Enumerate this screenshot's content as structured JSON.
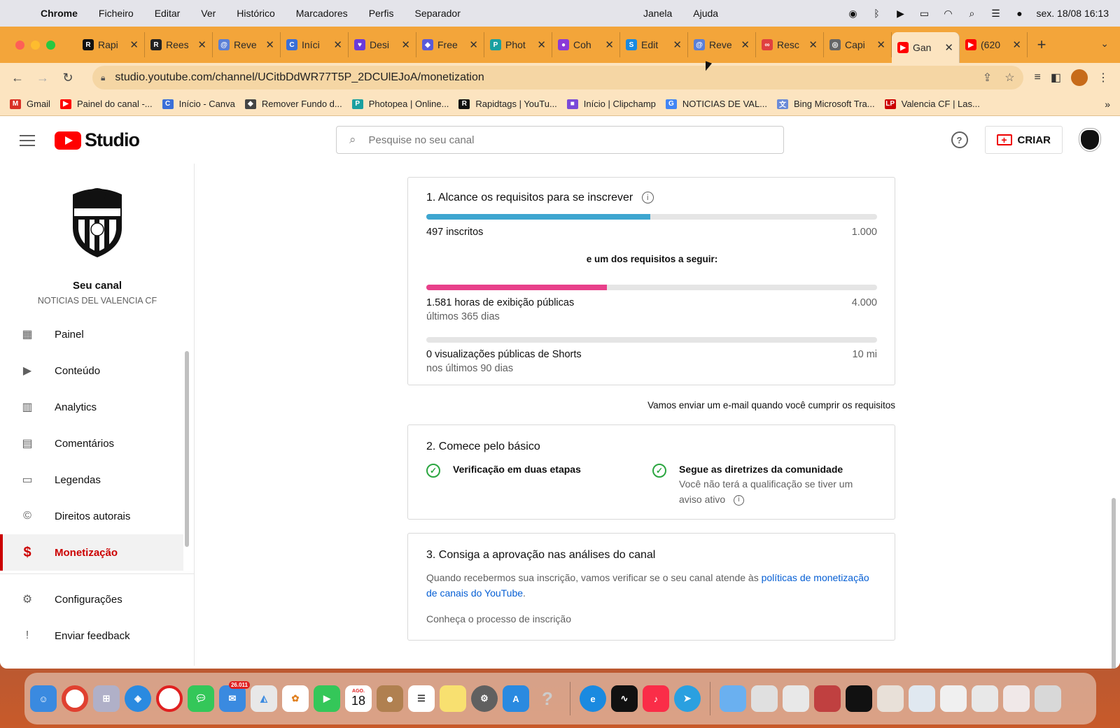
{
  "menubar": {
    "app": "Chrome",
    "items": [
      "Ficheiro",
      "Editar",
      "Ver",
      "Histórico",
      "Marcadores",
      "Perfis",
      "Separador"
    ],
    "center_items": [
      "Janela",
      "Ajuda"
    ],
    "datetime": "sex. 18/08  16:13"
  },
  "tabs": [
    {
      "title": "Rapi",
      "icon": "R",
      "color": "#111"
    },
    {
      "title": "Rees",
      "icon": "R",
      "color": "#222"
    },
    {
      "title": "Reve",
      "icon": "@",
      "color": "#5a7fd6"
    },
    {
      "title": "Iníci",
      "icon": "C",
      "color": "#3a6fd8"
    },
    {
      "title": "Desi",
      "icon": "♥",
      "color": "#6a3ad8"
    },
    {
      "title": "Free",
      "icon": "◆",
      "color": "#5a5ad8"
    },
    {
      "title": "Phot",
      "icon": "P",
      "color": "#1aa0a0"
    },
    {
      "title": "Coh",
      "icon": "●",
      "color": "#8a3ad8"
    },
    {
      "title": "Edit",
      "icon": "S",
      "color": "#1a8ae0"
    },
    {
      "title": "Reve",
      "icon": "@",
      "color": "#5a7fd6"
    },
    {
      "title": "Resc",
      "icon": "∞",
      "color": "#e04040"
    },
    {
      "title": "Capi",
      "icon": "◎",
      "color": "#666"
    },
    {
      "title": "Gan",
      "icon": "▶",
      "color": "#ff0000",
      "active": true
    },
    {
      "title": "(620",
      "icon": "▶",
      "color": "#ff0000"
    }
  ],
  "address": {
    "url": "studio.youtube.com/channel/UCitbDdWR77T5P_2DCUlEJoA/monetization"
  },
  "bookmarks": [
    {
      "label": "Gmail",
      "icon": "M",
      "color": "#d93025"
    },
    {
      "label": "Painel do canal -...",
      "icon": "▶",
      "color": "#ff0000"
    },
    {
      "label": "Início - Canva",
      "icon": "C",
      "color": "#3a6fd8"
    },
    {
      "label": "Remover Fundo d...",
      "icon": "◆",
      "color": "#444"
    },
    {
      "label": "Photopea | Online...",
      "icon": "P",
      "color": "#1aa0a0"
    },
    {
      "label": "Rapidtags | YouTu...",
      "icon": "R",
      "color": "#111"
    },
    {
      "label": "Início | Clipchamp",
      "icon": "■",
      "color": "#7a4ad8"
    },
    {
      "label": "NOTICIAS DE VAL...",
      "icon": "G",
      "color": "#4285f4"
    },
    {
      "label": "Bing Microsoft Tra...",
      "icon": "文",
      "color": "#6a8ad8"
    },
    {
      "label": "Valencia CF | Las...",
      "icon": "LP",
      "color": "#c00"
    }
  ],
  "header": {
    "logo_text": "Studio",
    "search_placeholder": "Pesquise no seu canal",
    "create_label": "CRIAR"
  },
  "sidebar": {
    "channel_title": "Seu canal",
    "channel_name": "NOTICIAS DEL VALENCIA CF",
    "items": [
      {
        "label": "Painel",
        "icon": "dashboard-icon"
      },
      {
        "label": "Conteúdo",
        "icon": "content-icon"
      },
      {
        "label": "Analytics",
        "icon": "analytics-icon"
      },
      {
        "label": "Comentários",
        "icon": "comments-icon"
      },
      {
        "label": "Legendas",
        "icon": "subtitles-icon"
      },
      {
        "label": "Direitos autorais",
        "icon": "copyright-icon"
      },
      {
        "label": "Monetização",
        "icon": "dollar-icon",
        "active": true
      }
    ],
    "bottom_items": [
      {
        "label": "Configurações",
        "icon": "gear-icon"
      },
      {
        "label": "Enviar feedback",
        "icon": "feedback-icon"
      }
    ]
  },
  "step1": {
    "title": "1. Alcance os requisitos para se inscrever",
    "subscribers": {
      "label": "497 inscritos",
      "limit": "1.000",
      "progress": 0.497,
      "color": "#3ea6d0"
    },
    "either_label": "e um dos requisitos a seguir:",
    "watch_hours": {
      "label": "1.581 horas de exibição públicas",
      "sub": "últimos 365 dias",
      "limit": "4.000",
      "progress": 0.4,
      "color": "#e8408a"
    },
    "shorts": {
      "label": "0 visualizações públicas de Shorts",
      "sub": "nos últimos 90 dias",
      "limit": "10 mi",
      "progress": 0,
      "color": "#e8408a"
    }
  },
  "email_note": "Vamos enviar um e-mail quando você cumprir os requisitos",
  "step2": {
    "title": "2. Comece pelo básico",
    "req1": "Verificação em duas etapas",
    "req2": "Segue as diretrizes da comunidade",
    "req2_desc": "Você não terá a qualificação se tiver um aviso ativo"
  },
  "step3": {
    "title": "3. Consiga a aprovação nas análises do canal",
    "text": "Quando recebermos sua inscrição, vamos verificar se o seu canal atende às ",
    "link": "políticas de monetização de canais do YouTube",
    "text_end": ".",
    "process_link": "Conheça o processo de inscrição"
  },
  "dock": {
    "mail_badge": "26.011",
    "calendar_month": "AGO.",
    "calendar_day": "18"
  }
}
